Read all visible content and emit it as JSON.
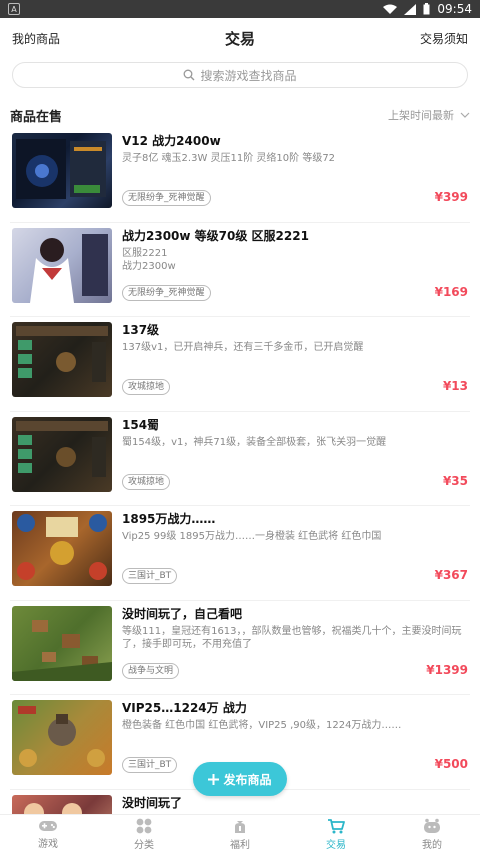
{
  "status_bar": {
    "time": "09:54"
  },
  "header": {
    "left": "我的商品",
    "title": "交易",
    "right": "交易须知"
  },
  "search": {
    "placeholder": "搜索游戏查找商品"
  },
  "section": {
    "title": "商品在售",
    "sort": "上架时间最新"
  },
  "listings": [
    {
      "title": "V12 战力2400w",
      "desc": "灵子8亿 魂玉2.3W 灵压11阶 灵络10阶 等级72",
      "tag": "无限纷争_死神觉醒",
      "price": "¥399"
    },
    {
      "title": "战力2300w 等级70级 区服2221",
      "desc": "区服2221\n战力2300w",
      "tag": "无限纷争_死神觉醒",
      "price": "¥169"
    },
    {
      "title": "137级",
      "desc": "137级v1，已开启神兵，还有三千多金币，已开启觉醒",
      "tag": "攻城掠地",
      "price": "¥13"
    },
    {
      "title": "154蜀",
      "desc": "蜀154级，v1，神兵71级，装备全部极套，张飞关羽一觉醒",
      "tag": "攻城掠地",
      "price": "¥35"
    },
    {
      "title": "1895万战力……",
      "desc": "Vip25 99级 1895万战力……一身橙装 红色武将 红色巾国",
      "tag": "三国计_BT",
      "price": "¥367"
    },
    {
      "title": "没时间玩了，自己看吧",
      "desc": "等级111，皇冠还有1613，，部队数量也管够，祝福类几十个，主要没时间玩了，接手即可玩，不用充值了",
      "tag": "战争与文明",
      "price": "¥1399"
    },
    {
      "title": "VIP25…1224万 战力",
      "desc": "橙色装备 红色巾国 红色武将，VIP25 ,90级，1224万战力……",
      "tag": "三国计_BT",
      "price": "¥500"
    },
    {
      "title": "没时间玩了",
      "desc": "",
      "tag": "",
      "price": ""
    }
  ],
  "fab": {
    "label": "发布商品"
  },
  "tabs": [
    {
      "label": "游戏",
      "icon": "gamepad-icon"
    },
    {
      "label": "分类",
      "icon": "grid-icon"
    },
    {
      "label": "福利",
      "icon": "gift-bag-icon"
    },
    {
      "label": "交易",
      "icon": "cart-icon"
    },
    {
      "label": "我的",
      "icon": "robot-face-icon"
    }
  ],
  "colors": {
    "accent": "#2bb6c9",
    "price": "#f24a5b",
    "fab": "#3cc7d8"
  }
}
